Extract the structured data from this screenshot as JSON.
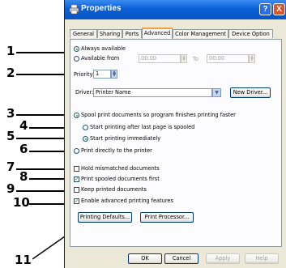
{
  "window": {
    "title": "Properties",
    "help_label": "?",
    "close_label": "X"
  },
  "tabs": [
    "General",
    "Sharing",
    "Ports",
    "Advanced",
    "Color Management",
    "Device Option"
  ],
  "availability": {
    "always_label": "Always available",
    "from_label": "Available from",
    "from_time": "00:00",
    "to_label": "To",
    "to_time": "00:00",
    "selected": "always"
  },
  "priority": {
    "label": "Priority:",
    "value": "1"
  },
  "driver": {
    "label": "Driver:",
    "value": "Printer Name",
    "new_driver_label": "New Driver..."
  },
  "spool": {
    "spool_label": "Spool print documents so program finishes printing faster",
    "after_last_page_label": "Start printing after last page is spooled",
    "immediately_label": "Start printing immediately",
    "direct_label": "Print directly to the printer"
  },
  "options": [
    {
      "label": "Hold mismatched documents",
      "checked": false
    },
    {
      "label": "Print spooled documents first",
      "checked": true
    },
    {
      "label": "Keep printed documents",
      "checked": false
    },
    {
      "label": "Enable advanced printing features",
      "checked": true
    }
  ],
  "buttons": {
    "defaults": "Printing Defaults...",
    "processor": "Print Processor...",
    "ok": "OK",
    "cancel": "Cancel",
    "apply": "Apply",
    "help": "Help"
  },
  "callouts": [
    "1",
    "2",
    "3",
    "4",
    "5",
    "6",
    "7",
    "8",
    "9",
    "10",
    "11"
  ]
}
